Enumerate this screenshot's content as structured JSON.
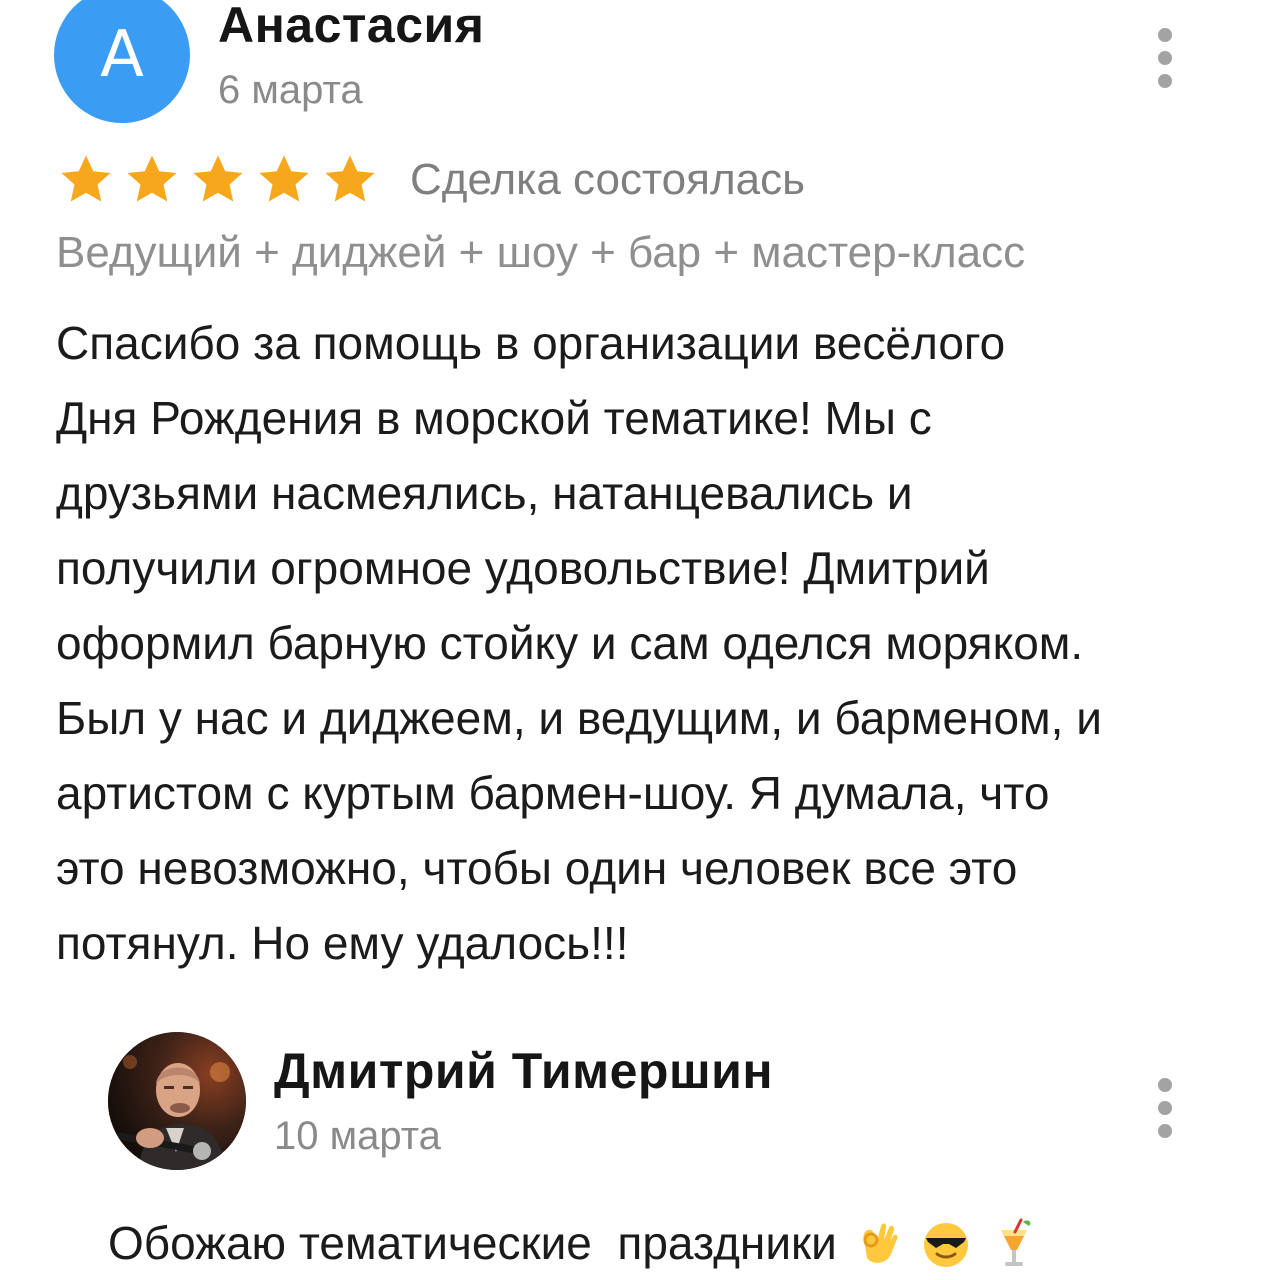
{
  "review": {
    "avatar_letter": "А",
    "author": "Анастасия",
    "date": "6 марта",
    "rating": 5,
    "rating_max": 5,
    "deal_status": "Сделка состоялась",
    "service": "Ведущий + диджей + шоу + бар + мастер-класс",
    "text_lines": [
      "Спасибо за помощь в организации весёлого",
      "Дня Рождения в морской тематике! Мы с",
      "друзьями насмеялись, натанцевались и",
      "получили огромное удовольствие! Дмитрий",
      "оформил барную стойку и сам оделся моряком.",
      "Был у нас и диджеем, и ведущим, и барменом, и",
      "артистом с куртым бармен-шоу. Я думала, что",
      "это невозможно, чтобы один человек все это",
      "потянул. Но ему удалось!!!"
    ]
  },
  "reply": {
    "author": "Дмитрий Тимершин",
    "date": "10 марта",
    "text": "Обожаю тематические  праздники",
    "emojis": [
      "ok-hand-emoji",
      "sunglasses-emoji",
      "tropical-drink-emoji"
    ]
  },
  "colors": {
    "avatar_bg": "#3a9cf2",
    "star": "#f6a71b",
    "muted_text": "#8a8a8a",
    "kebab": "#a3a3a3"
  }
}
